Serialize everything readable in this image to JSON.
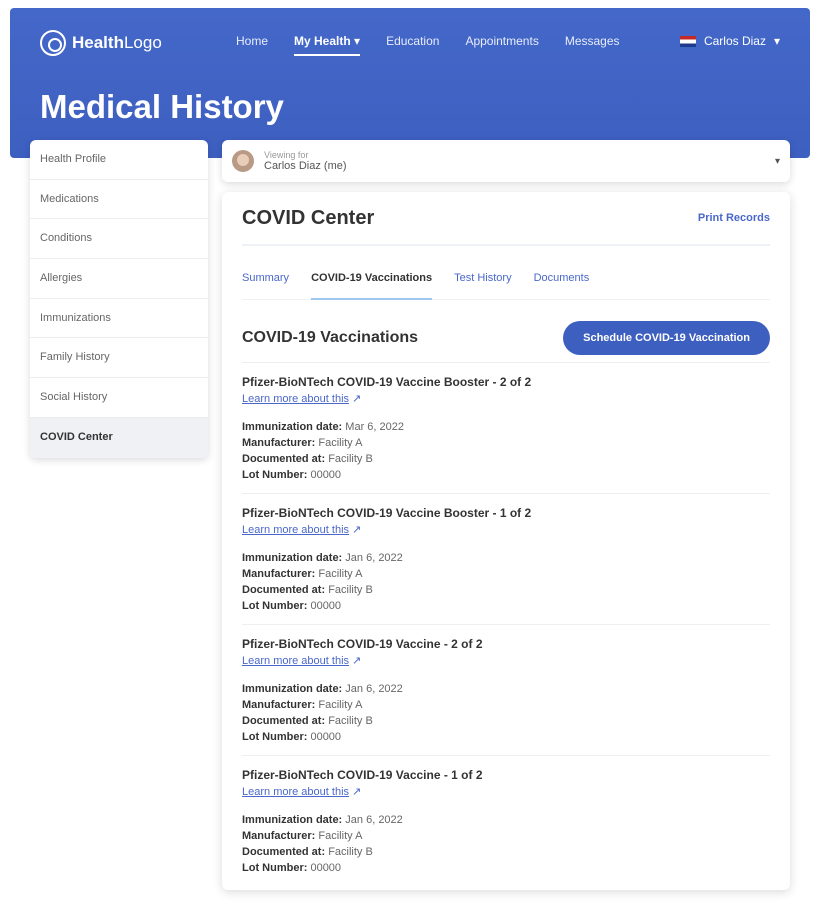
{
  "brand": {
    "name_bold": "Health",
    "name_light": "Logo"
  },
  "nav": [
    "Home",
    "My Health",
    "Education",
    "Appointments",
    "Messages"
  ],
  "nav_active": "My Health",
  "user": {
    "name": "Carlos Diaz"
  },
  "page_title": "Medical History",
  "sidebar": [
    "Health Profile",
    "Medications",
    "Conditions",
    "Allergies",
    "Immunizations",
    "Family History",
    "Social History",
    "COVID Center"
  ],
  "viewing": {
    "label": "Viewing for",
    "name": "Carlos Diaz (me)"
  },
  "card": {
    "title": "COVID Center",
    "print": "Print Records",
    "tabs": [
      "Summary",
      "COVID-19 Vaccinations",
      "Test History",
      "Documents"
    ],
    "active_tab": "COVID-19 Vaccinations",
    "section_title": "COVID-19 Vaccinations",
    "schedule_button": "Schedule COVID-19 Vaccination"
  },
  "field_labels": {
    "date": "Immunization date:",
    "manufacturer": "Manufacturer:",
    "documented": "Documented at:",
    "lot": "Lot Number:"
  },
  "vaccinations": [
    {
      "name": "Pfizer-BioNTech COVID-19 Vaccine Booster - 2 of 2",
      "link": "Learn more about this",
      "date": "Mar 6, 2022",
      "manufacturer": "Facility A",
      "documented": "Facility B",
      "lot": "00000"
    },
    {
      "name": "Pfizer-BioNTech COVID-19 Vaccine Booster - 1 of 2",
      "link": "Learn more about this",
      "date": "Jan 6, 2022",
      "manufacturer": "Facility A",
      "documented": "Facility B",
      "lot": "00000"
    },
    {
      "name": "Pfizer-BioNTech COVID-19 Vaccine - 2 of 2",
      "link": "Learn more about this",
      "date": "Jan 6, 2022",
      "manufacturer": "Facility A",
      "documented": "Facility B",
      "lot": "00000"
    },
    {
      "name": "Pfizer-BioNTech COVID-19 Vaccine - 1 of 2",
      "link": "Learn more about this",
      "date": "Jan 6, 2022",
      "manufacturer": "Facility A",
      "documented": "Facility B",
      "lot": "00000"
    }
  ],
  "colors": {
    "brand": "#3d5fc0",
    "link": "#4a67c9",
    "tab_underline": "#9ec8f0"
  }
}
